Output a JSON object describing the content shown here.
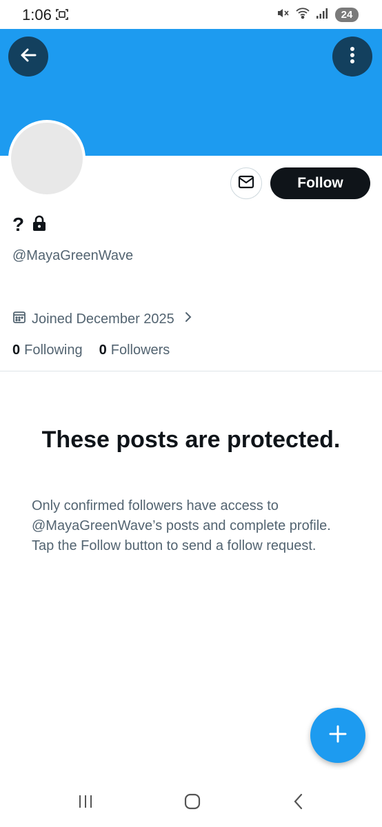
{
  "status_bar": {
    "time": "1:06",
    "battery": "24",
    "icons": [
      "screenshot-icon",
      "mute-icon",
      "wifi-icon",
      "signal-icon",
      "battery-icon"
    ]
  },
  "banner": {
    "color": "#1d9bf0"
  },
  "profile": {
    "display_name": "?",
    "handle": "@MayaGreenWave",
    "joined": "Joined December 2025",
    "following_count": "0",
    "following_label": "Following",
    "followers_count": "0",
    "followers_label": "Followers",
    "follow_button": "Follow"
  },
  "protected": {
    "title": "These posts are protected.",
    "body": "Only confirmed followers have access to @MayaGreenWave’s posts and complete profile. Tap the Follow button to send a follow request."
  },
  "colors": {
    "accent": "#1d9bf0",
    "text_primary": "#0f1419",
    "text_secondary": "#536471",
    "follow_button_bg": "#0f1419"
  }
}
